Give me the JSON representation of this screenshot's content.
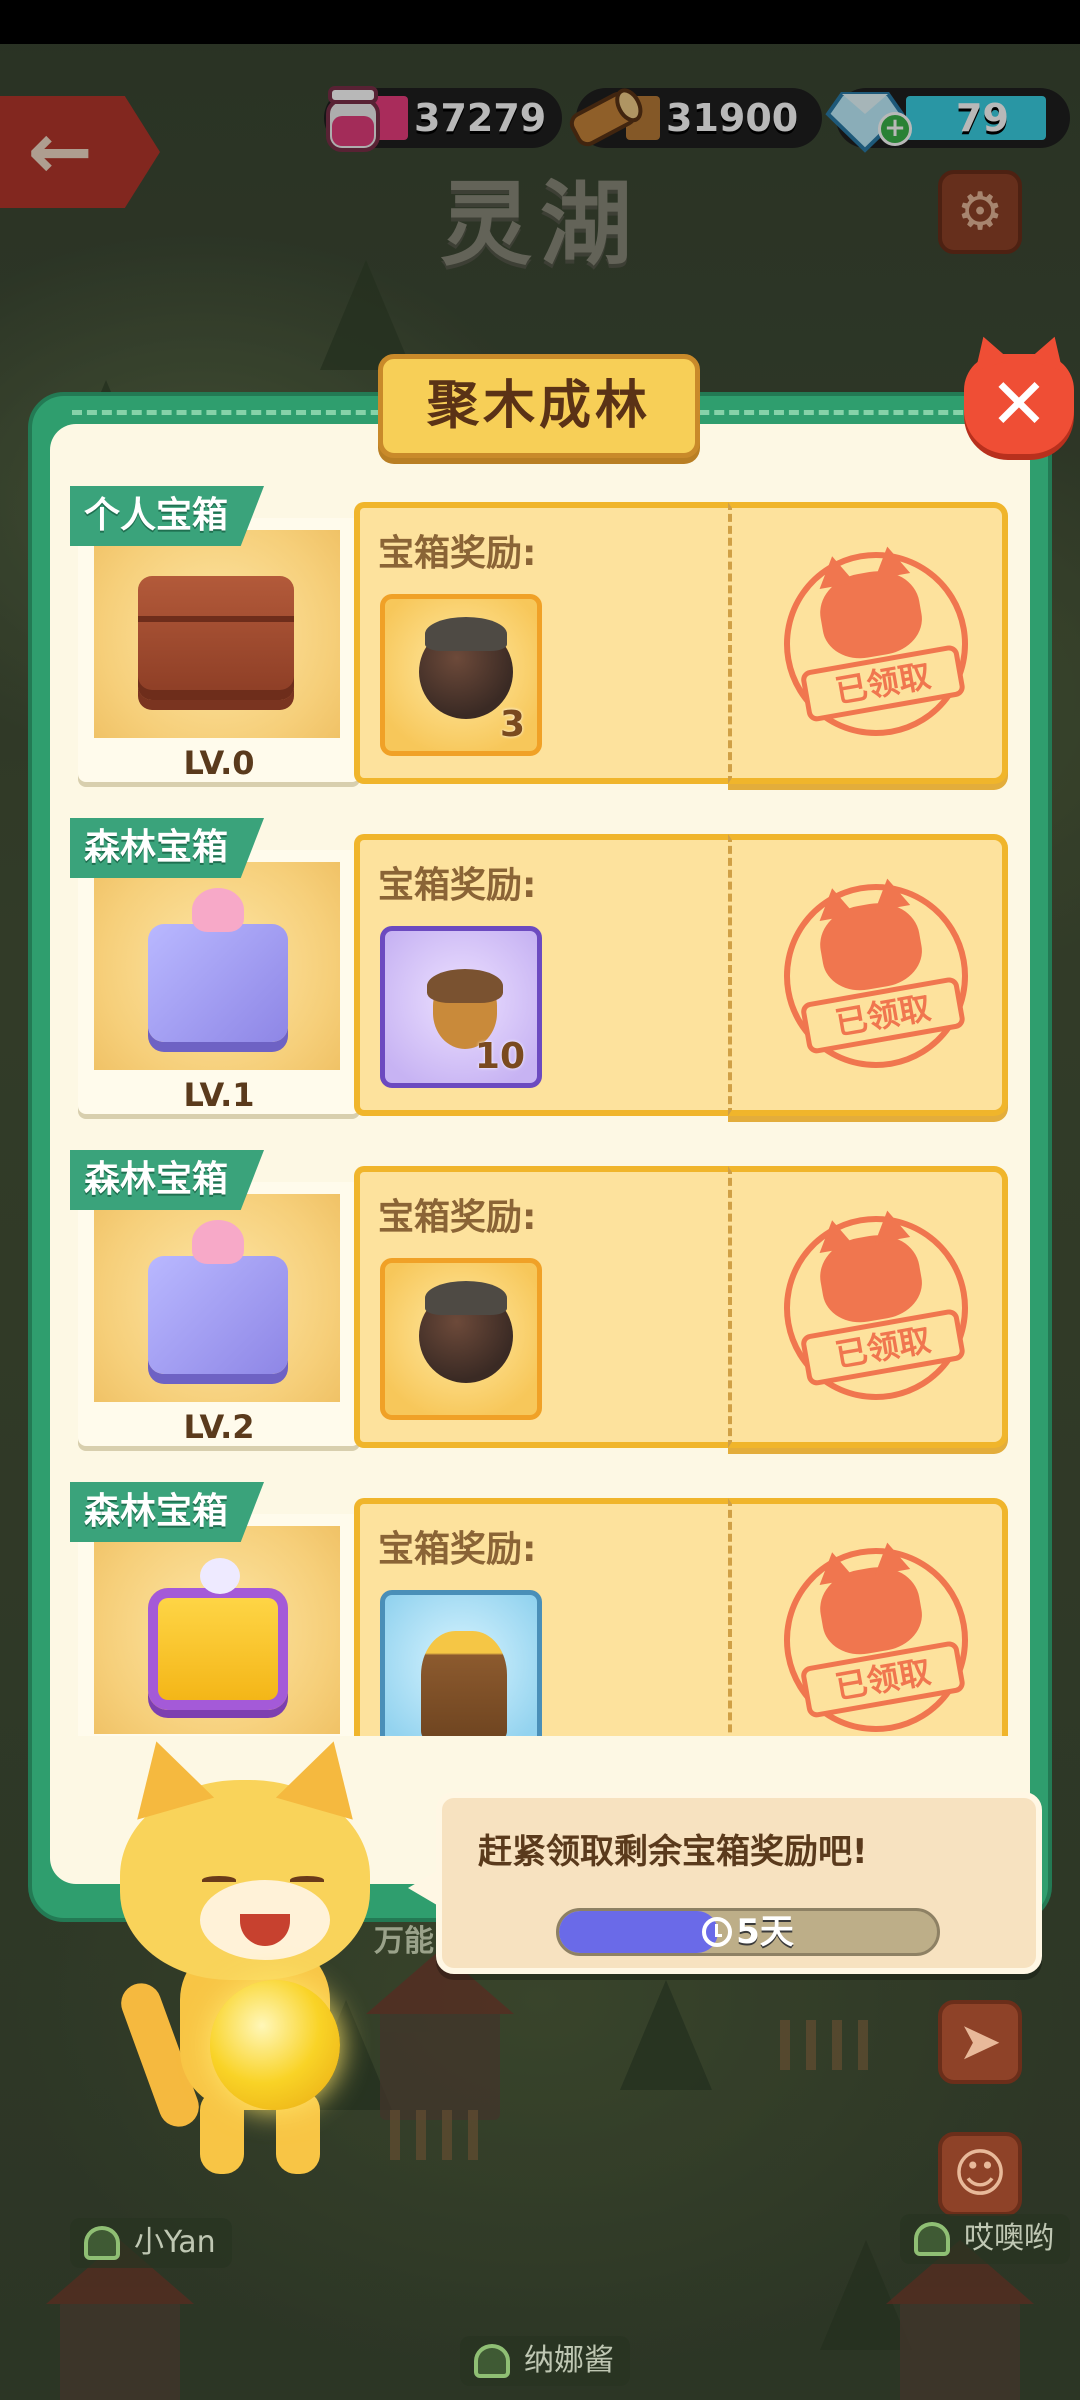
{
  "map": {
    "title": "灵湖",
    "hidden_label": "万能",
    "players": [
      {
        "name": "小Yan"
      },
      {
        "name": "哎噢哟"
      },
      {
        "name": "纳娜酱"
      }
    ]
  },
  "currencies": {
    "jam": {
      "value": "37279",
      "icon": "jam-jar-icon"
    },
    "wood": {
      "value": "31900",
      "icon": "wood-log-icon"
    },
    "gems": {
      "value": "79",
      "icon": "gem-icon",
      "add_icon": "plus-icon"
    }
  },
  "panel": {
    "title": "聚木成林",
    "close_icon": "close-icon",
    "chests": [
      {
        "tag": "个人宝箱",
        "level": "LV.0",
        "reward_label": "宝箱奖励:",
        "reward_icon": "fertilizer-pot-icon",
        "reward_count": "3",
        "status": "已领取",
        "tile": "gold",
        "art": "wood"
      },
      {
        "tag": "森林宝箱",
        "level": "LV.1",
        "reward_label": "宝箱奖励:",
        "reward_icon": "acorn-icon",
        "reward_count": "10",
        "status": "已领取",
        "tile": "purple",
        "art": "gift"
      },
      {
        "tag": "森林宝箱",
        "level": "LV.2",
        "reward_label": "宝箱奖励:",
        "reward_icon": "fertilizer-pot-icon",
        "reward_count": "",
        "status": "已领取",
        "tile": "gold",
        "art": "gift"
      },
      {
        "tag": "森林宝箱",
        "level": "",
        "reward_label": "宝箱奖励:",
        "reward_icon": "tree-stump-icon",
        "reward_count": "",
        "status": "已领取",
        "tile": "blue",
        "art": "gold"
      }
    ]
  },
  "dialog": {
    "message": "赶紧领取剩余宝箱奖励吧!",
    "timer_label": "5天",
    "timer_progress": 0.42
  },
  "colors": {
    "panel_green": "#2f9e6e",
    "stamp_orange": "#f0764f",
    "card_gold": "#f0b52b"
  }
}
